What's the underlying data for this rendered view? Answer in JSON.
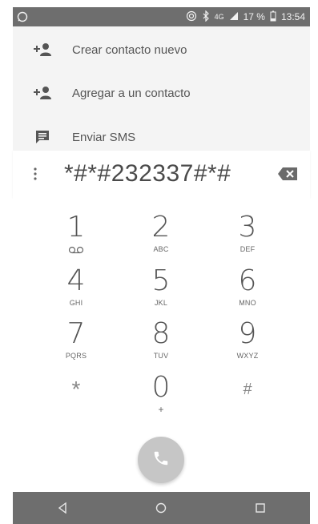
{
  "status_bar": {
    "notification_icon": "whatsapp-icon",
    "network": "4G",
    "battery_percent": "17 %",
    "time": "13:54"
  },
  "suggestions": [
    {
      "label": "Crear contacto nuevo",
      "icon": "add-person-icon"
    },
    {
      "label": "Agregar a un contacto",
      "icon": "add-person-icon"
    },
    {
      "label": "Enviar SMS",
      "icon": "message-icon"
    }
  ],
  "dialer": {
    "digits": "*#*#232337#*#"
  },
  "keypad": [
    {
      "num": "1",
      "letters": ""
    },
    {
      "num": "2",
      "letters": "ABC"
    },
    {
      "num": "3",
      "letters": "DEF"
    },
    {
      "num": "4",
      "letters": "GHI"
    },
    {
      "num": "5",
      "letters": "JKL"
    },
    {
      "num": "6",
      "letters": "MNO"
    },
    {
      "num": "7",
      "letters": "PQRS"
    },
    {
      "num": "8",
      "letters": "TUV"
    },
    {
      "num": "9",
      "letters": "WXYZ"
    },
    {
      "num": "*",
      "letters": ""
    },
    {
      "num": "0",
      "letters": "+"
    },
    {
      "num": "#",
      "letters": ""
    }
  ],
  "colors": {
    "status_bar": "#6e6e6e",
    "call_button": "#c6c6c6"
  }
}
